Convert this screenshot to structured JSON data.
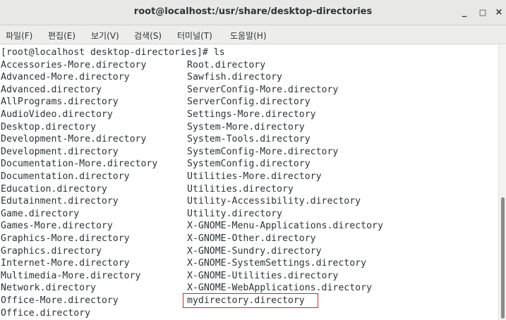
{
  "window": {
    "title": "root@localhost:/usr/share/desktop-directories",
    "minimize_glyph": "_",
    "maximize_glyph": "□",
    "close_glyph": "×"
  },
  "menu": {
    "items": [
      "파일(F)",
      "편집(E)",
      "보기(V)",
      "검색(S)",
      "터미널(T)",
      "도움말(H)"
    ]
  },
  "terminal": {
    "prompt_line": "[root@localhost desktop-directories]# ls",
    "left_column": [
      "Accessories-More.directory",
      "Advanced-More.directory",
      "Advanced.directory",
      "AllPrograms.directory",
      "AudioVideo.directory",
      "Desktop.directory",
      "Development-More.directory",
      "Development.directory",
      "Documentation-More.directory",
      "Documentation.directory",
      "Education.directory",
      "Edutainment.directory",
      "Game.directory",
      "Games-More.directory",
      "Graphics-More.directory",
      "Graphics.directory",
      "Internet-More.directory",
      "Multimedia-More.directory",
      "Network.directory",
      "Office-More.directory",
      "Office.directory"
    ],
    "right_column": [
      "Root.directory",
      "Sawfish.directory",
      "ServerConfig-More.directory",
      "ServerConfig.directory",
      "Settings-More.directory",
      "System-More.directory",
      "System-Tools.directory",
      "SystemConfig-More.directory",
      "SystemConfig.directory",
      "Utilities-More.directory",
      "Utilities.directory",
      "Utility-Accessibility.directory",
      "Utility.directory",
      "X-GNOME-Menu-Applications.directory",
      "X-GNOME-Other.directory",
      "X-GNOME-Sundry.directory",
      "X-GNOME-SystemSettings.directory",
      "X-GNOME-Utilities.directory",
      "X-GNOME-WebApplications.directory",
      "mydirectory.directory"
    ],
    "highlighted_entry": "mydirectory.directory",
    "highlight_color": "#e02020"
  }
}
